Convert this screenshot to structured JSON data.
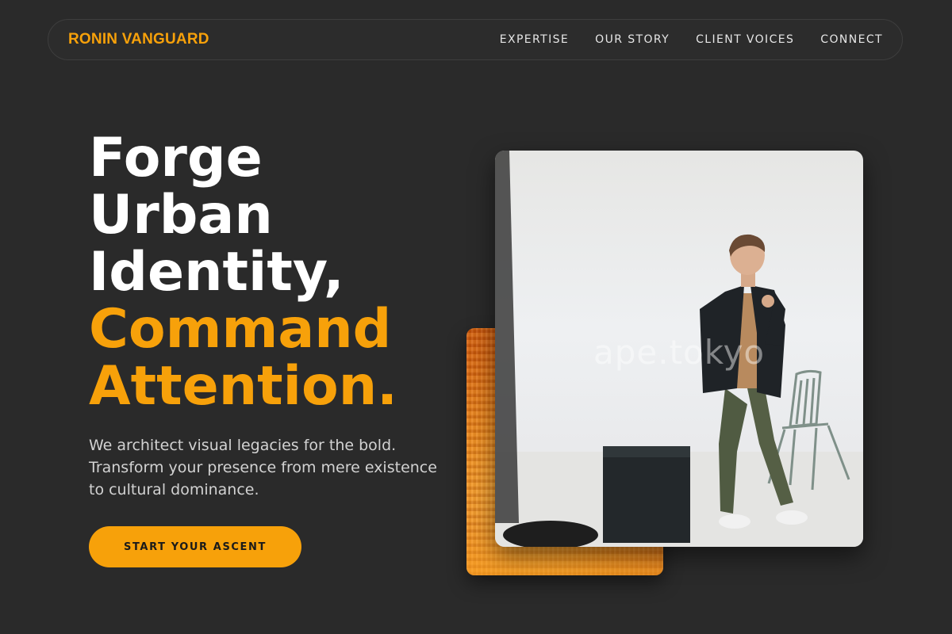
{
  "nav": {
    "brand": "RONIN VANGUARD",
    "links": [
      {
        "label": "EXPERTISE"
      },
      {
        "label": "OUR STORY"
      },
      {
        "label": "CLIENT VOICES"
      },
      {
        "label": "CONNECT"
      }
    ]
  },
  "hero": {
    "headline": {
      "lines": [
        "Forge",
        "Urban",
        "Identity,"
      ],
      "accent_lines": [
        "Command",
        "Attention."
      ]
    },
    "lead_lines": [
      "We architect visual legacies for the bold.",
      "Transform your presence from mere existence",
      "to cultural dominance."
    ],
    "cta_label": "START YOUR ASCENT"
  },
  "media": {
    "photo_watermark": "ape.tokyo",
    "photo_subject": "man-in-blazer-photo",
    "texture_subject": "orange-paint-texture"
  },
  "colors": {
    "background": "#2a2a2a",
    "accent": "#f7a10a",
    "text_primary": "#ffffff",
    "text_secondary": "#d2d2d2"
  }
}
